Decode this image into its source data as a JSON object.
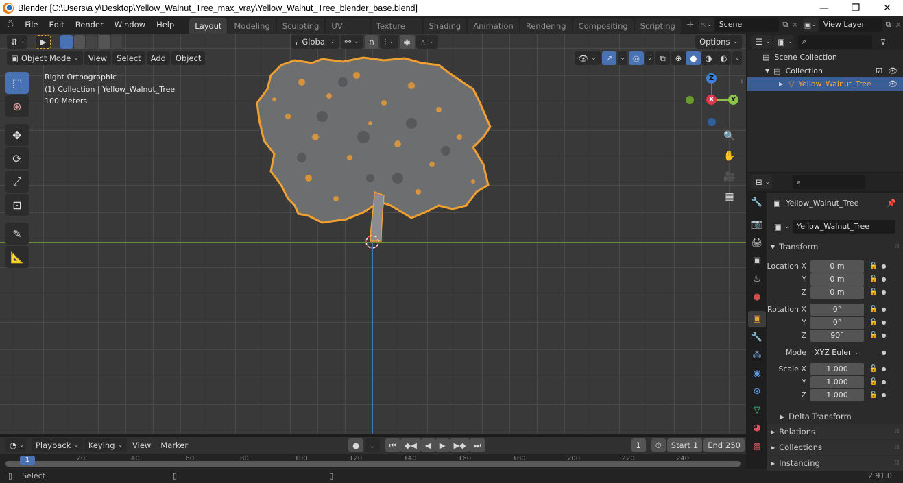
{
  "window": {
    "title": "Blender [C:\\Users\\a y\\Desktop\\Yellow_Walnut_Tree_max_vray\\Yellow_Walnut_Tree_blender_base.blend]",
    "controls": [
      "—",
      "❐",
      "✕"
    ]
  },
  "menu": [
    "File",
    "Edit",
    "Render",
    "Window",
    "Help"
  ],
  "workspaces": [
    {
      "label": "Layout",
      "active": true
    },
    {
      "label": "Modeling"
    },
    {
      "label": "Sculpting"
    },
    {
      "label": "UV Editing"
    },
    {
      "label": "Texture Paint"
    },
    {
      "label": "Shading"
    },
    {
      "label": "Animation"
    },
    {
      "label": "Rendering"
    },
    {
      "label": "Compositing"
    },
    {
      "label": "Scripting"
    }
  ],
  "scene": {
    "label": "Scene"
  },
  "view_layer": {
    "label": "View Layer"
  },
  "viewport": {
    "transform_orientation": "Global",
    "options_label": "Options",
    "mode": "Object Mode",
    "menus": [
      "View",
      "Select",
      "Add",
      "Object"
    ],
    "overlay": {
      "view_name": "Right Orthographic",
      "collection_info": "(1) Collection | Yellow_Walnut_Tree",
      "scale": "100 Meters"
    },
    "gizmo": {
      "x": "X",
      "y": "Y",
      "z": "Z"
    },
    "object_name": "Yellow_Walnut_Tree",
    "colors": {
      "selection_outline": "#f0a030",
      "y_axis_line": "#6b8b3c",
      "z_axis_line": "#3f78bd"
    }
  },
  "timeline": {
    "menus": [
      "Playback",
      "Keying",
      "View",
      "Marker"
    ],
    "current_frame": "1",
    "start_label": "Start",
    "start": "1",
    "end_label": "End",
    "end": "250",
    "ticks": [
      "1",
      "20",
      "40",
      "60",
      "80",
      "100",
      "120",
      "140",
      "160",
      "180",
      "200",
      "220",
      "240"
    ]
  },
  "statusbar": {
    "left": "Select",
    "version": "2.91.0"
  },
  "outliner": {
    "items": [
      {
        "label": "Scene Collection",
        "depth": 0
      },
      {
        "label": "Collection",
        "depth": 1
      },
      {
        "label": "Yellow_Walnut_Tree",
        "depth": 2,
        "selected": true
      }
    ]
  },
  "properties": {
    "object_header": "Yellow_Walnut_Tree",
    "object_name_field": "Yellow_Walnut_Tree",
    "transform_label": "Transform",
    "location": {
      "label": "Location X",
      "x": "0 m",
      "y": "0 m",
      "z": "0 m"
    },
    "rotation": {
      "label": "Rotation X",
      "x": "0°",
      "y": "0°",
      "z": "90°"
    },
    "mode": {
      "label": "Mode",
      "value": "XYZ Euler"
    },
    "scale": {
      "label": "Scale X",
      "x": "1.000",
      "y": "1.000",
      "z": "1.000"
    },
    "axis_y": "Y",
    "axis_z": "Z",
    "subpanels": [
      "Delta Transform",
      "Relations",
      "Collections",
      "Instancing"
    ]
  }
}
